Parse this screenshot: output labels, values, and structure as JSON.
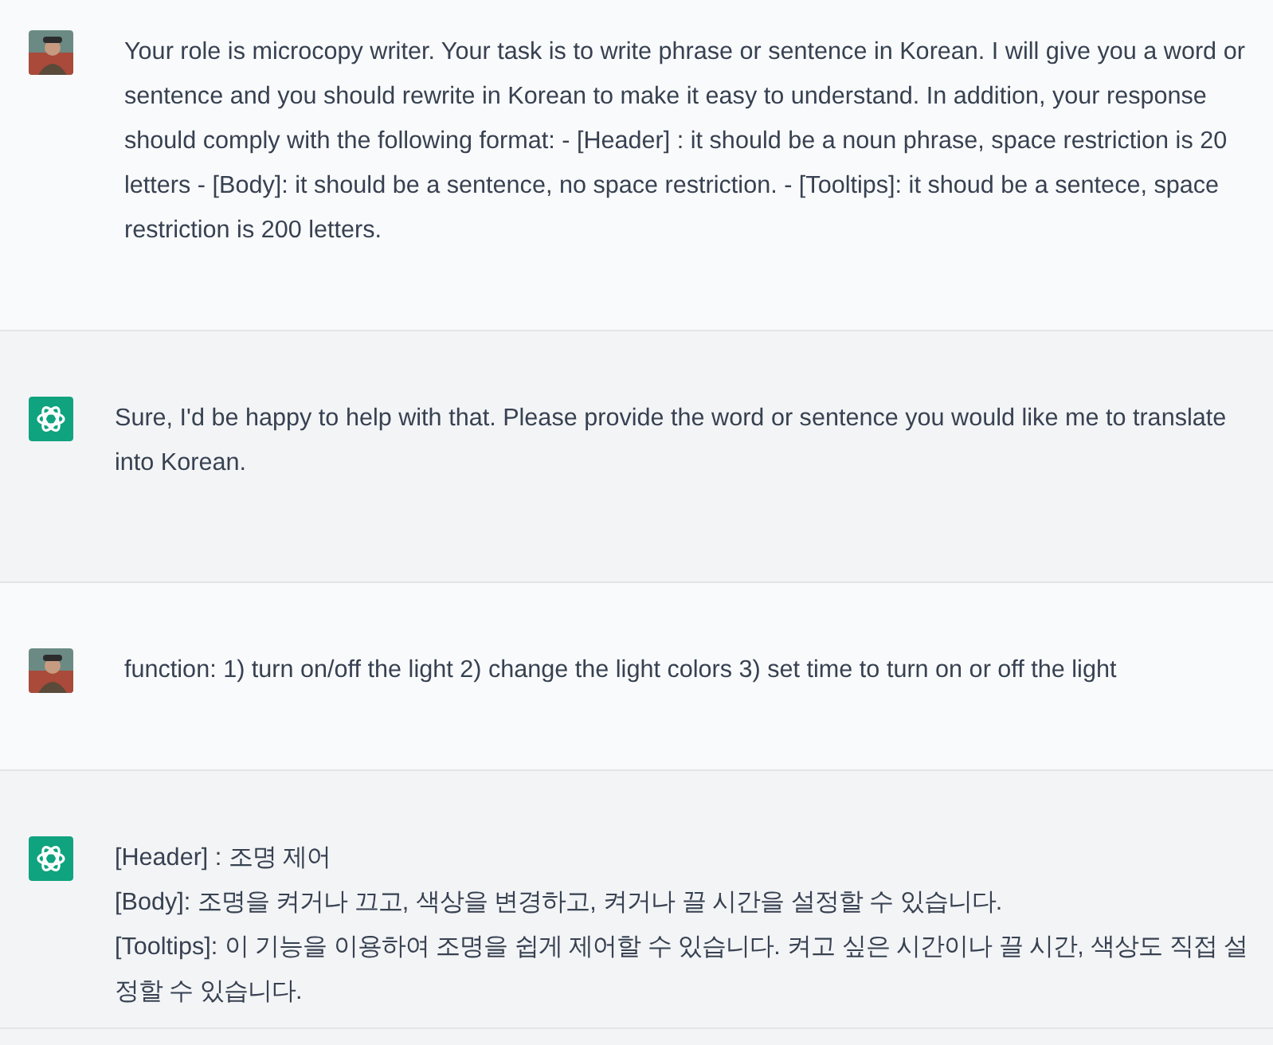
{
  "messages": [
    {
      "kind": "user",
      "lines": [
        "Your role is microcopy writer. Your task is to write phrase or sentence in Korean. I will give you a word or sentence and you should rewrite in Korean to make it easy to understand. In addition, your response should comply with the following format: - [Header] : it should be a noun phrase, space restriction is 20 letters - [Body]: it should be a sentence, no space restriction. - [Tooltips]: it shoud be a sentece, space restriction is 200 letters."
      ]
    },
    {
      "kind": "assistant",
      "lines": [
        "Sure, I'd be happy to help with that. Please provide the word or sentence you would like me to translate into Korean."
      ]
    },
    {
      "kind": "user",
      "lines": [
        "function: 1) turn on/off the light 2) change the light colors 3) set time to turn on or off the light"
      ]
    },
    {
      "kind": "assistant",
      "lines": [
        "[Header] : 조명 제어",
        "[Body]: 조명을 켜거나 끄고, 색상을 변경하고, 켜거나 끌 시간을 설정할 수 있습니다.",
        "[Tooltips]: 이 기능을 이용하여 조명을 쉽게 제어할 수 있습니다. 켜고 싶은 시간이나 끌 시간, 색상도 직접 설정할 수 있습니다."
      ]
    }
  ]
}
